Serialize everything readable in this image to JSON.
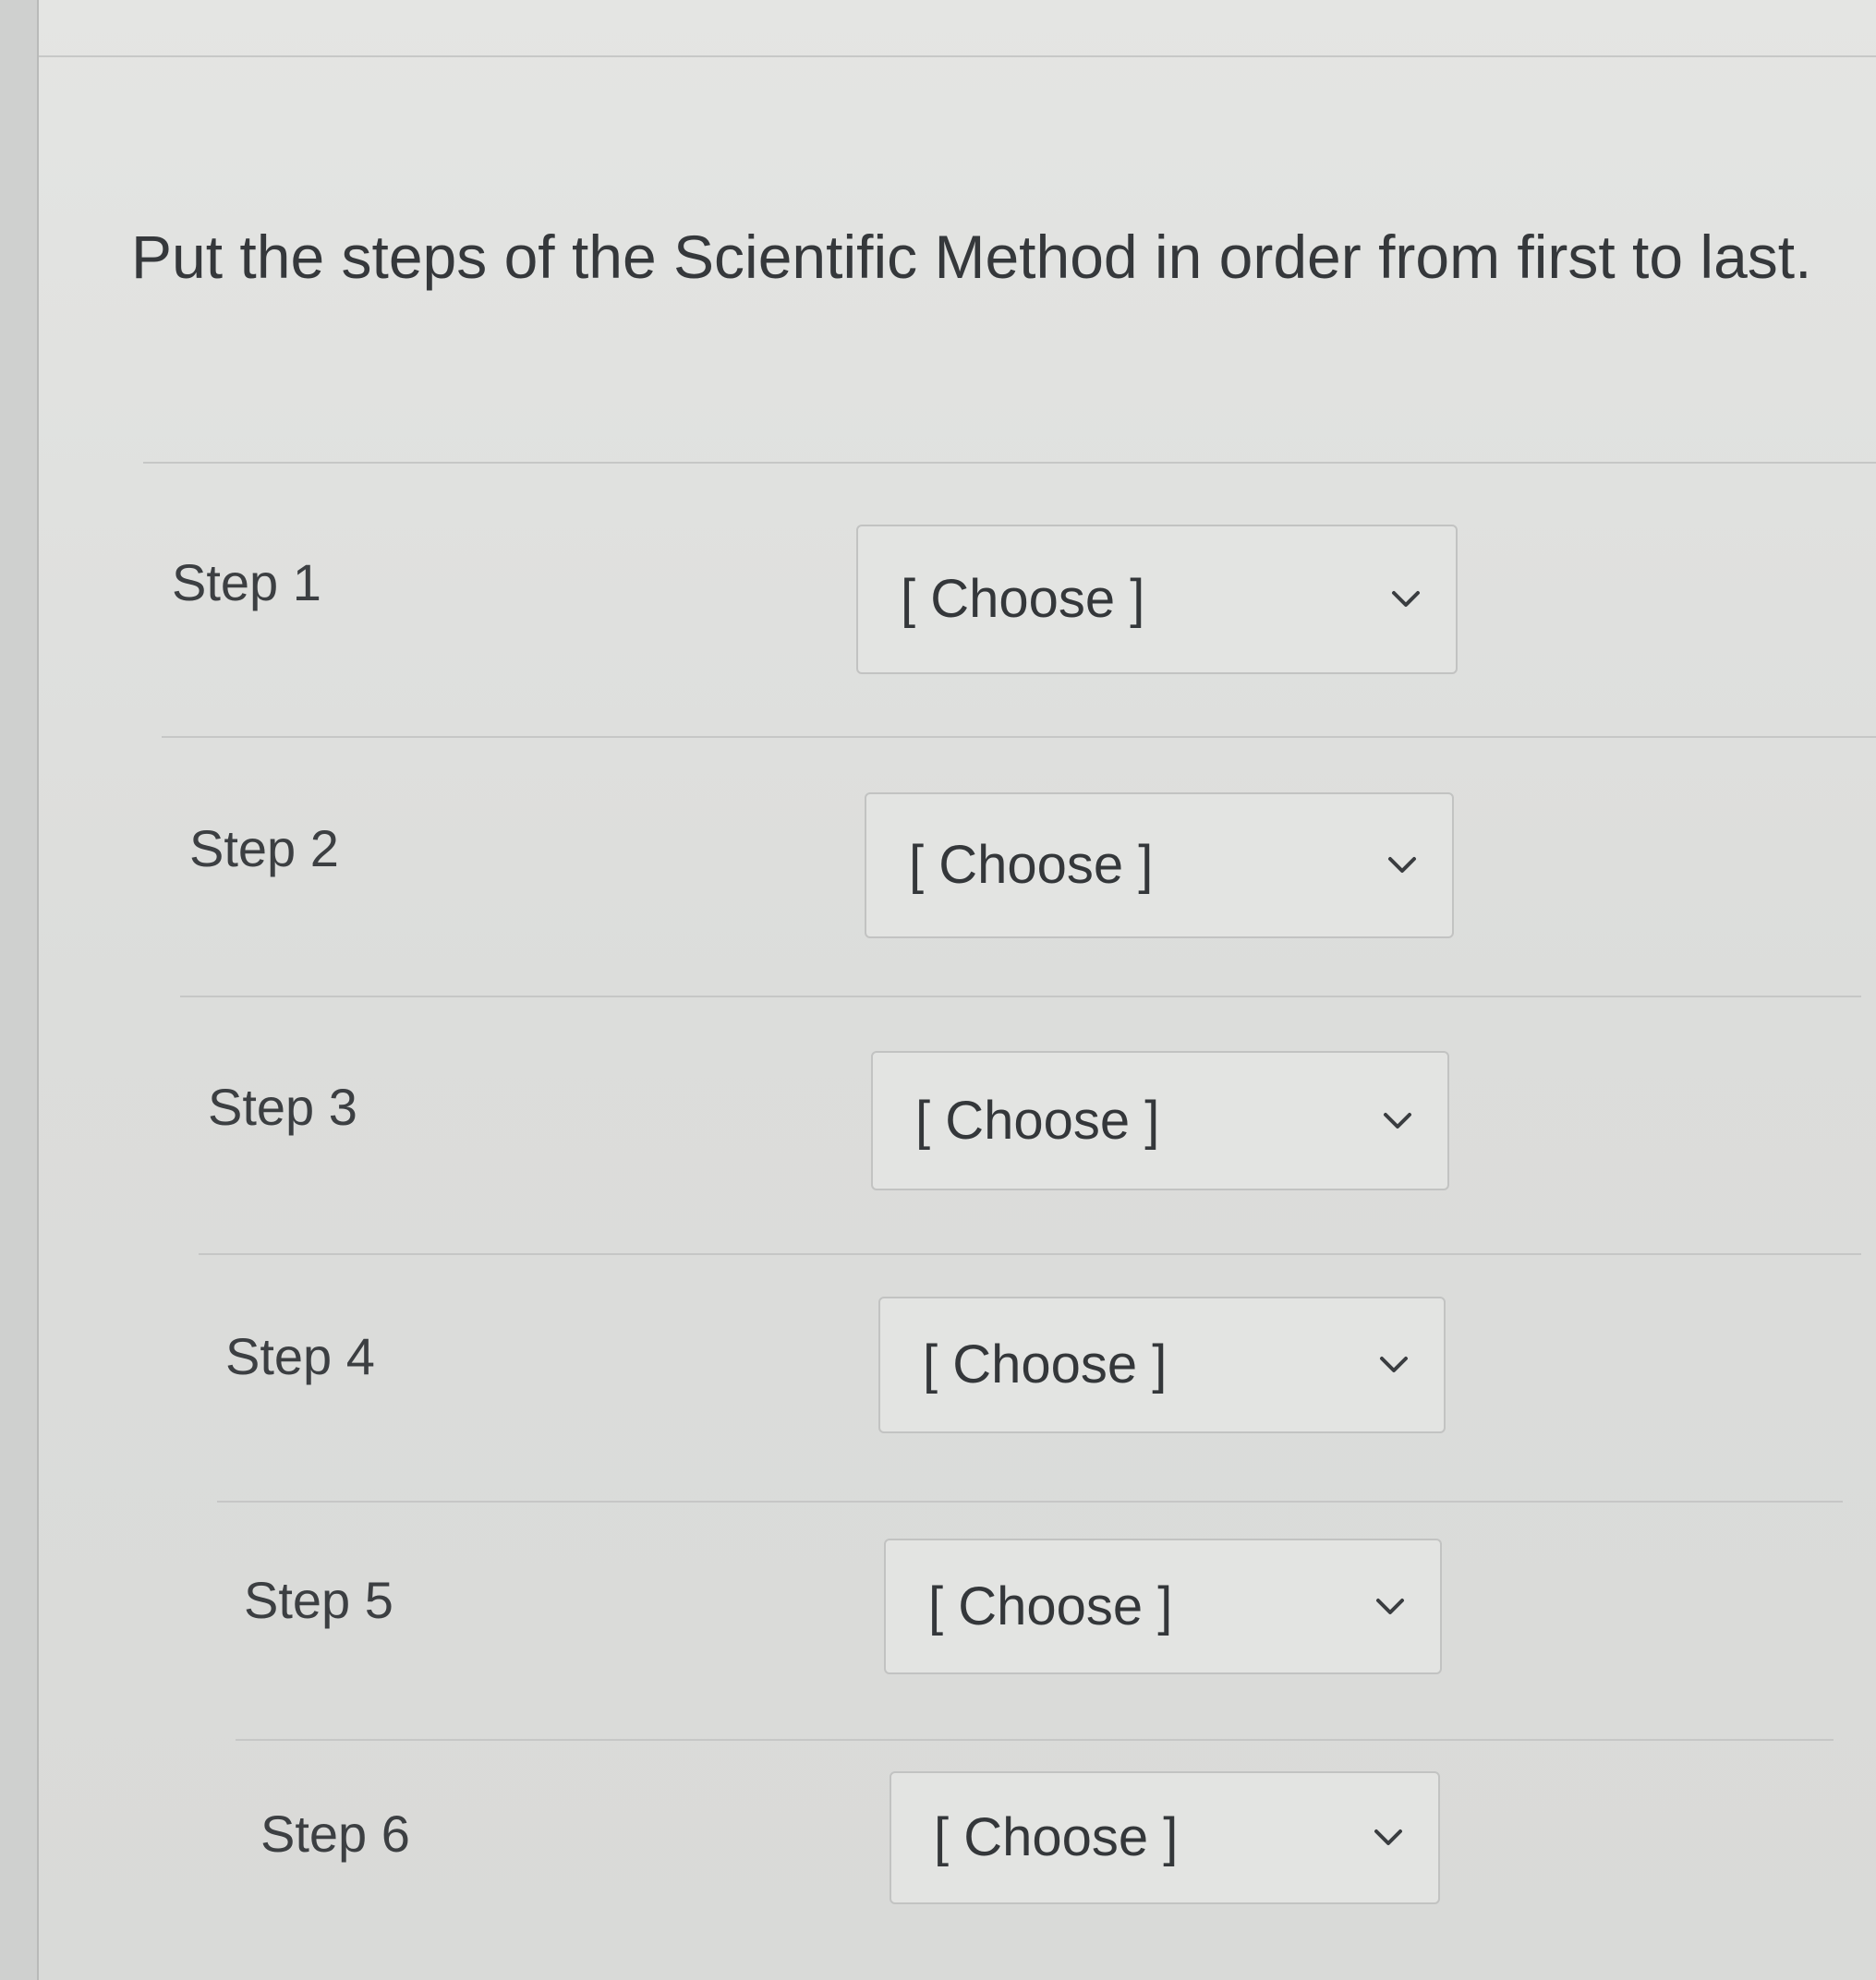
{
  "question": {
    "text": "Put the steps of the Scientific Method in order from first to last."
  },
  "steps": [
    {
      "label": "Step 1",
      "selected": "[ Choose ]"
    },
    {
      "label": "Step 2",
      "selected": "[ Choose ]"
    },
    {
      "label": "Step 3",
      "selected": "[ Choose ]"
    },
    {
      "label": "Step 4",
      "selected": "[ Choose ]"
    },
    {
      "label": "Step 5",
      "selected": "[ Choose ]"
    },
    {
      "label": "Step 6",
      "selected": "[ Choose ]"
    }
  ],
  "icons": {
    "dropdown": "chevron-down-icon"
  },
  "colors": {
    "background": "#dcdddb",
    "text": "#35383b",
    "border": "#c2c3c2"
  }
}
